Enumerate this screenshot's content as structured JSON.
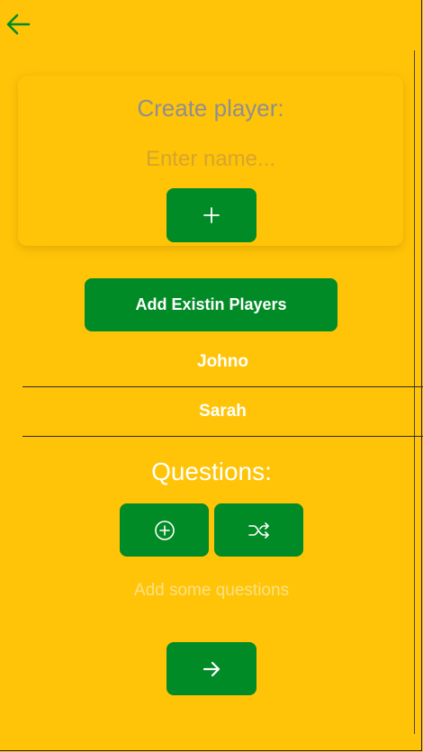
{
  "colors": {
    "background": "#FFC407",
    "button": "#018B26",
    "back_arrow": "#018B26",
    "title_gray": "#8f8f8f",
    "placeholder": "#d6a52c",
    "empty_text": "#fbe186"
  },
  "nav": {
    "back_icon": "arrow-left-icon"
  },
  "create_player": {
    "title": "Create player:",
    "input_value": "",
    "input_placeholder": "Enter name...",
    "add_icon": "plus-icon"
  },
  "players": {
    "add_existing_label": "Add Existin Players",
    "list": [
      {
        "name": "Johno"
      },
      {
        "name": "Sarah"
      }
    ]
  },
  "questions": {
    "title": "Questions:",
    "add_icon": "plus-circle-icon",
    "shuffle_icon": "shuffle-icon",
    "empty_text": "Add some questions"
  },
  "footer": {
    "next_icon": "arrow-right-icon"
  }
}
